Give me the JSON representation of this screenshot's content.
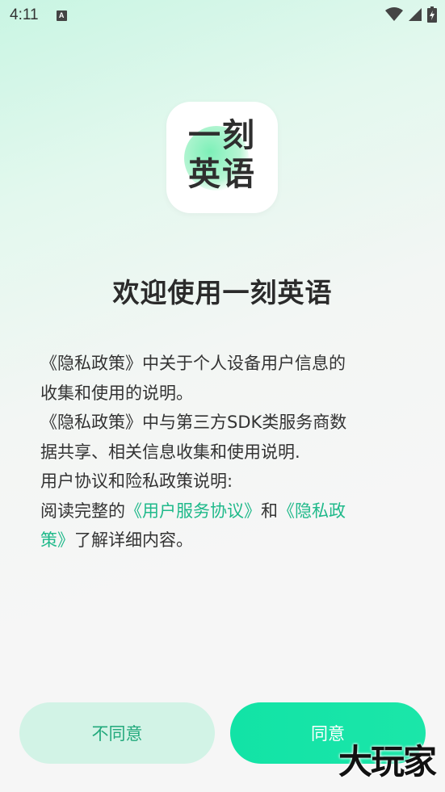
{
  "status_bar": {
    "time": "4:11",
    "notification_icon_letter": "A"
  },
  "app": {
    "logo_line1": "一刻",
    "logo_line2": "英语",
    "welcome_title": "欢迎使用一刻英语"
  },
  "policy": {
    "line1": "《隐私政策》中关于个人设备用户信息的",
    "line2": "收集和使用的说明。",
    "line3": "《隐私政策》中与第三方SDK类服务商数",
    "line4": "据共享、相关信息收集和使用说明.",
    "line5": "用户协议和险私政策说明:",
    "line6_prefix": "阅读完整的",
    "user_agreement_link": "《用户服务协议》",
    "and_text": "和",
    "privacy_link_part1": "《隐私政",
    "privacy_link_part2": "策》",
    "line7_suffix": "了解详细内容。"
  },
  "buttons": {
    "decline": "不同意",
    "agree": "同意"
  },
  "watermark": "大玩家",
  "colors": {
    "accent": "#1fb98a",
    "agree_button": "#14e3a6",
    "decline_button": "#d2f3e6"
  }
}
